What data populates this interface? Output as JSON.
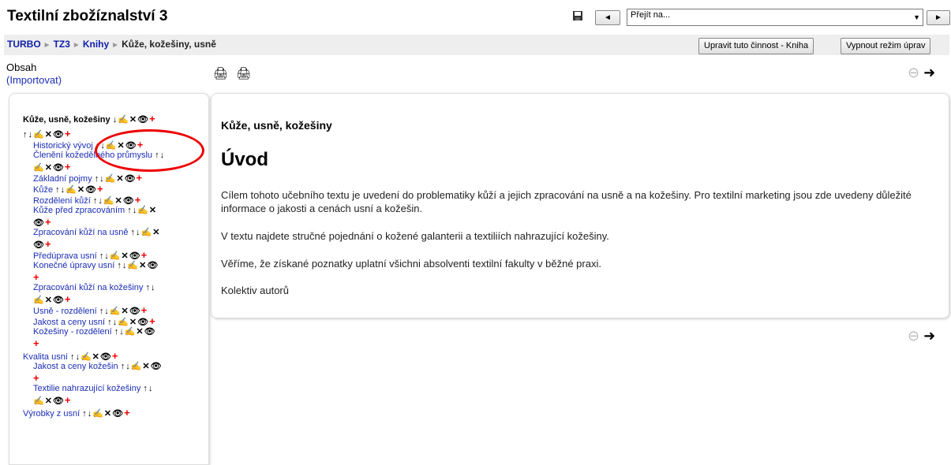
{
  "header": {
    "title": "Textilní zbožíznalství 3",
    "jump_value": "Přejít na...",
    "prev_label": "◄",
    "next_label": "►"
  },
  "breadcrumb": {
    "items": [
      "TURBO",
      "TZ3",
      "Knihy"
    ],
    "current": "Kůže, kožešiny, usně"
  },
  "buttons": {
    "edit": "Upravit tuto činnost - Kniha",
    "edit_off": "Vypnout režim úprav"
  },
  "toc": {
    "heading": "Obsah",
    "import": "(Importovat)",
    "root": "Kůže, usně, kožešiny",
    "items": [
      "Historický vývoj",
      "Členění kožedělného průmyslu",
      "Základní pojmy",
      "Kůže",
      "Rozdělení kůží",
      "Kůže před zpracováním",
      "Zpracování kůží na usně",
      "Předúprava usní",
      "Konečné úpravy usní",
      "Zpracování kůží na kožešiny",
      "Usně - rozdělení",
      "Jakost a ceny usní",
      "Kožešiny - rozdělení",
      "Kvalita usní",
      "Jakost a ceny kožešin",
      "Textilie nahrazující kožešiny",
      "Výrobky z usní"
    ]
  },
  "content": {
    "chapter_title": "Kůže, usně, kožešiny",
    "heading": "Úvod",
    "paragraphs": [
      "Cílem tohoto učebního textu je uvedení do problematiky kůží a jejich zpracování na usně a na kožešiny. Pro textilní marketing jsou zde uvedeny důležité informace o jakosti a cenách usní a kožešin.",
      "V textu najdete stručné pojednání o kožené galanterii a textiliích nahrazující kožešiny.",
      "Věříme, že získané poznatky uplatní všichni absolventi textilní fakulty v běžné praxi.",
      "Kolektiv autorů"
    ]
  },
  "colors": {
    "link": "#1b2db5",
    "add_icon": "#ee0000",
    "annotation": "#ee0000"
  }
}
